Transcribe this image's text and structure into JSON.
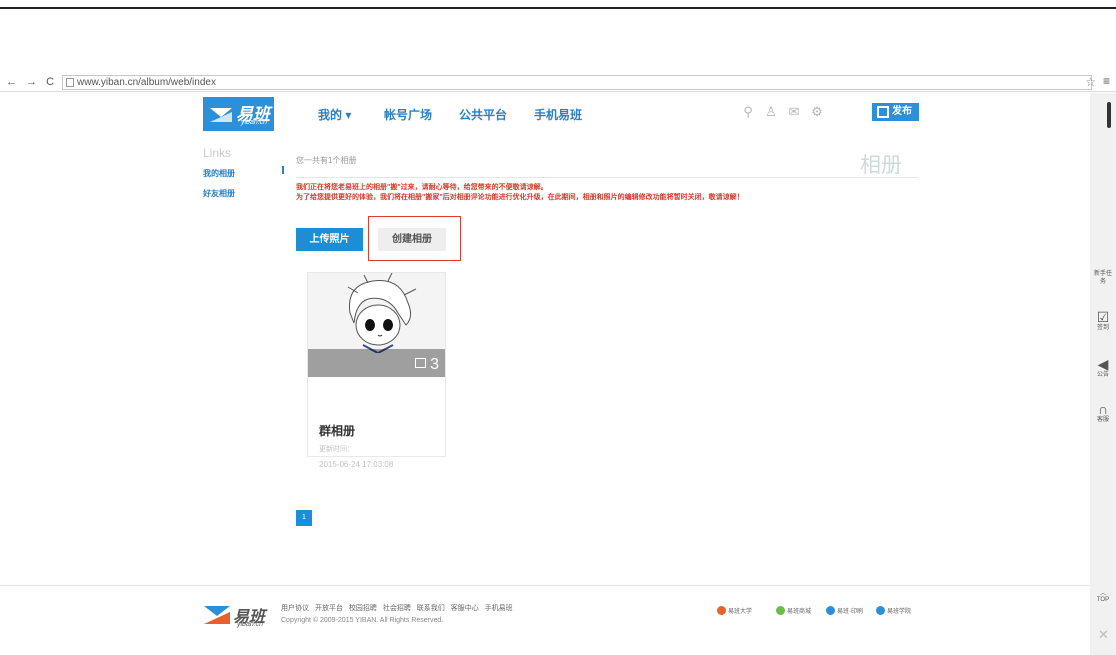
{
  "browser": {
    "url": "www.yiban.cn/album/web/index"
  },
  "header": {
    "logo_text": "易班",
    "logo_sub": "yiban.cn",
    "nav": [
      {
        "label": "我的 ▾"
      },
      {
        "label": "帐号广场"
      },
      {
        "label": "公共平台"
      },
      {
        "label": "手机易班"
      }
    ],
    "publish_label": "发布",
    "colors": {
      "brand": "#2c8fd7",
      "alert": "#d23b2b"
    }
  },
  "sidebar": {
    "title": "Links",
    "items": [
      {
        "label": "我的相册"
      },
      {
        "label": "好友相册"
      }
    ]
  },
  "main": {
    "count_text": "您一共有1个相册",
    "page_title": "相册",
    "notice_1": "我们正在将您老易班上的相册\"搬\"过来，请耐心等待，给您带来的不便敬请谅解。",
    "notice_2": "为了给您提供更好的体验，我们将在相册\"搬家\"后对相册评论功能进行优化升级，在此期间，相册和照片的编辑修改功能将暂时关闭，敬请谅解！",
    "upload_label": "上传照片",
    "create_label": "创建相册",
    "albums": [
      {
        "name": "群相册",
        "photo_count": "3",
        "updated_label": "更新时间：",
        "updated_time": "2015-06-24 17:03:08"
      }
    ],
    "pagination": {
      "current": "1"
    }
  },
  "footer": {
    "logo_text": "易班",
    "logo_sub": "yiban.cn",
    "links": "用户协议 开放平台 校园招聘 社会招聘 联系我们 客服中心 手机易班",
    "copyright": "Copyright © 2009-2015 YIBAN. All Rights Reserved.",
    "partners": [
      {
        "label": "易班大学"
      },
      {
        "label": "易班商城"
      },
      {
        "label": "易班·印刷"
      },
      {
        "label": "易班学院"
      }
    ]
  },
  "rail": {
    "items": [
      {
        "label": "新手任务"
      },
      {
        "label": "签到"
      },
      {
        "label": "公告"
      },
      {
        "label": "客服"
      }
    ],
    "top_label": "TOP"
  }
}
